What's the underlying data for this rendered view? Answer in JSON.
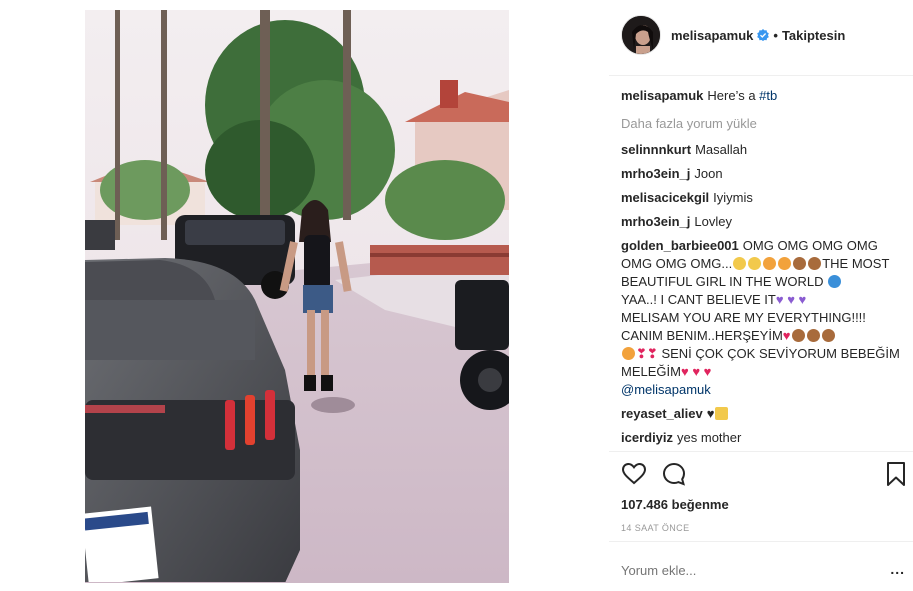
{
  "post": {
    "username": "melisapamuk",
    "follow_dot": "•",
    "follow_status": "Takiptesin"
  },
  "caption": {
    "user": "melisapamuk",
    "text": "Here’s a ",
    "hashtag": "#tb"
  },
  "load_more": "Daha fazla yorum yükle",
  "comments": [
    {
      "user": "selinnnkurt",
      "text": "Masallah"
    },
    {
      "user": "mrho3ein_j",
      "text": "Joon"
    },
    {
      "user": "melisacicekgil",
      "text": "Iyiymis"
    },
    {
      "user": "mrho3ein_j",
      "text": "Lovley"
    }
  ],
  "long_comment": {
    "user": "golden_barbiee001",
    "part1": "OMG OMG OMG OMG OMG OMG OMG...",
    "part2": "THE MOST BEAUTIFUL GIRL IN THE WORLD",
    "part3": "YAA..! I CANT BELIEVE IT",
    "part4": "MELISAM YOU ARE MY EVERYTHING!!!! CANIM BENIM..HERŞEYİM",
    "part5": "SENİ ÇOK ÇOK SEVİYORUM BEBEĞİM MELEĞİM",
    "mention": "@melisapamuk"
  },
  "comments_after": [
    {
      "user": "reyaset_aliev",
      "text": ""
    },
    {
      "user": "icerdiyiz",
      "text": "yes mother"
    }
  ],
  "likes_count": "107.486",
  "likes_label": "beğenme",
  "time_ago": "14 SAAT ÖNCE",
  "add_comment_placeholder": "Yorum ekle...",
  "more_options": "...",
  "icons": {
    "verified": "verified-badge-icon",
    "like": "heart-outline-icon",
    "comment": "speech-bubble-icon",
    "save": "bookmark-icon"
  },
  "colors": {
    "verified_blue": "#3897f0",
    "link_blue": "#003569",
    "muted": "#999999",
    "text": "#262626"
  }
}
